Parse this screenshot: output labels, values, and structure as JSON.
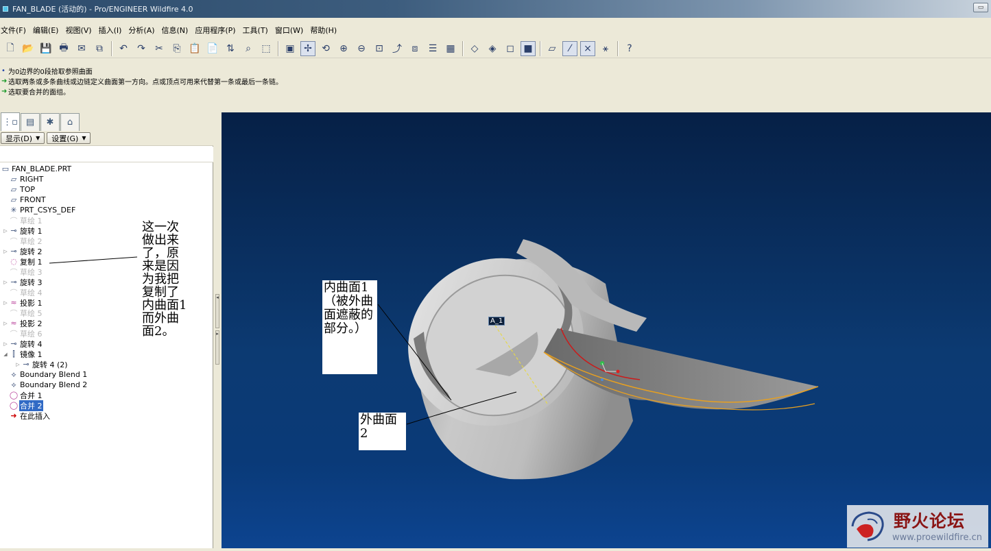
{
  "window": {
    "title": "FAN_BLADE (活动的) - Pro/ENGINEER Wildfire 4.0"
  },
  "menu": [
    "文件(F)",
    "编辑(E)",
    "视图(V)",
    "插入(I)",
    "分析(A)",
    "信息(N)",
    "应用程序(P)",
    "工具(T)",
    "窗口(W)",
    "帮助(H)"
  ],
  "toolbar": {
    "icons": [
      "new-icon",
      "open-icon",
      "save-icon",
      "print-icon",
      "send-mail-icon",
      "send-link-icon",
      "sep",
      "undo-icon",
      "redo-icon",
      "cut-icon",
      "copy-icon",
      "paste-icon",
      "paste-special-icon",
      "regenerate-icon",
      "find-icon",
      "select-box-icon",
      "sep",
      "repaint-icon",
      "spin-center-icon",
      "orient-icon",
      "zoom-in-icon",
      "zoom-out-icon",
      "refit-icon",
      "reorient-icon",
      "saved-views-icon",
      "layers-icon",
      "view-manager-icon",
      "sep",
      "wireframe-icon",
      "hidden-line-icon",
      "no-hidden-icon",
      "shading-icon",
      "sep",
      "datum-planes-icon",
      "datum-axes-icon",
      "datum-points-icon",
      "coordinate-systems-icon",
      "sep",
      "context-help-icon"
    ]
  },
  "messages": [
    {
      "type": "info",
      "text": "为0边界的0段拾取参照曲面"
    },
    {
      "type": "prompt",
      "text": "选取两条或多条曲线或边链定义曲面第一方向。点或顶点可用来代替第一条或最后一条链。"
    },
    {
      "type": "prompt",
      "text": "选取要合并的面组。"
    }
  ],
  "panel": {
    "show_label": "显示(D)",
    "settings_label": "设置(G)"
  },
  "tree": [
    {
      "label": "FAN_BLADE.PRT",
      "icon": "part-icon",
      "indent": 0,
      "state": "normal"
    },
    {
      "label": "RIGHT",
      "icon": "datum-plane-icon",
      "indent": 1,
      "state": "normal"
    },
    {
      "label": "TOP",
      "icon": "datum-plane-icon",
      "indent": 1,
      "state": "normal"
    },
    {
      "label": "FRONT",
      "icon": "datum-plane-icon",
      "indent": 1,
      "state": "normal"
    },
    {
      "label": "PRT_CSYS_DEF",
      "icon": "csys-icon",
      "indent": 1,
      "state": "normal"
    },
    {
      "label": "草绘 1",
      "icon": "sketch-icon",
      "indent": 1,
      "state": "dim"
    },
    {
      "label": "旋转 1",
      "icon": "revolve-icon",
      "indent": 1,
      "state": "normal",
      "expandable": true
    },
    {
      "label": "草绘 2",
      "icon": "sketch-icon",
      "indent": 1,
      "state": "dim"
    },
    {
      "label": "旋转 2",
      "icon": "revolve-icon",
      "indent": 1,
      "state": "normal",
      "expandable": true
    },
    {
      "label": "复制 1",
      "icon": "copy-surface-icon",
      "indent": 1,
      "state": "normal"
    },
    {
      "label": "草绘 3",
      "icon": "sketch-icon",
      "indent": 1,
      "state": "dim"
    },
    {
      "label": "旋转 3",
      "icon": "revolve-icon",
      "indent": 1,
      "state": "normal",
      "expandable": true
    },
    {
      "label": "草绘 4",
      "icon": "sketch-icon",
      "indent": 1,
      "state": "dim"
    },
    {
      "label": "投影 1",
      "icon": "projection-icon",
      "indent": 1,
      "state": "normal",
      "expandable": true
    },
    {
      "label": "草绘 5",
      "icon": "sketch-icon",
      "indent": 1,
      "state": "dim"
    },
    {
      "label": "投影 2",
      "icon": "projection-icon",
      "indent": 1,
      "state": "normal",
      "expandable": true
    },
    {
      "label": "草绘 6",
      "icon": "sketch-icon",
      "indent": 1,
      "state": "dim"
    },
    {
      "label": "旋转 4",
      "icon": "revolve-icon",
      "indent": 1,
      "state": "normal",
      "expandable": true
    },
    {
      "label": "镜像 1",
      "icon": "mirror-icon",
      "indent": 1,
      "state": "normal",
      "expanded": true
    },
    {
      "label": "旋转 4 (2)",
      "icon": "revolve-icon",
      "indent": 2,
      "state": "normal",
      "expandable": true
    },
    {
      "label": "Boundary Blend 1",
      "icon": "boundary-blend-icon",
      "indent": 1,
      "state": "normal"
    },
    {
      "label": "Boundary Blend 2",
      "icon": "boundary-blend-icon",
      "indent": 1,
      "state": "normal"
    },
    {
      "label": "合并 1",
      "icon": "merge-icon",
      "indent": 1,
      "state": "normal"
    },
    {
      "label": "合并 2",
      "icon": "merge-icon",
      "indent": 1,
      "state": "selected"
    },
    {
      "label": "在此插入",
      "icon": "insert-here-icon",
      "indent": 1,
      "state": "normal"
    }
  ],
  "annotations": {
    "left_note": "这一次做出来了，原来是因为我把复制了内曲面1而外曲面2。",
    "inner_surface": "内曲面1（被外曲面遮蔽的部分。）",
    "outer_surface": "外曲面2",
    "csys_label": "A_1"
  },
  "watermark": {
    "name": "野火论坛",
    "url": "www.proewildfire.cn"
  },
  "colors": {
    "viewport_top": "#062046",
    "viewport_bottom": "#0d4490",
    "selection": "#316ac5",
    "edge_highlight": "#e8a020",
    "curve_red": "#cc1a1a"
  }
}
